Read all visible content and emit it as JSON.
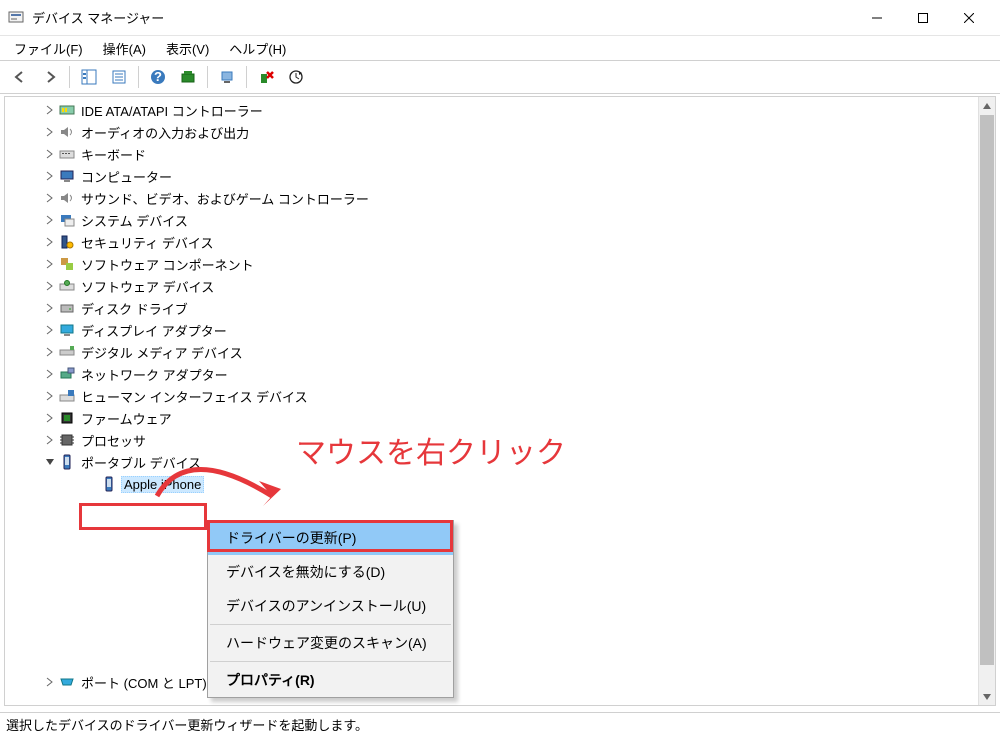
{
  "window": {
    "title": "デバイス マネージャー"
  },
  "menu": {
    "file": "ファイル(F)",
    "action": "操作(A)",
    "view": "表示(V)",
    "help": "ヘルプ(H)"
  },
  "tree": {
    "nodes": [
      {
        "label": "IDE ATA/ATAPI コントローラー"
      },
      {
        "label": "オーディオの入力および出力"
      },
      {
        "label": "キーボード"
      },
      {
        "label": "コンピューター"
      },
      {
        "label": "サウンド、ビデオ、およびゲーム コントローラー"
      },
      {
        "label": "システム デバイス"
      },
      {
        "label": "セキュリティ デバイス"
      },
      {
        "label": "ソフトウェア コンポーネント"
      },
      {
        "label": "ソフトウェア デバイス"
      },
      {
        "label": "ディスク ドライブ"
      },
      {
        "label": "ディスプレイ アダプター"
      },
      {
        "label": "デジタル メディア デバイス"
      },
      {
        "label": "ネットワーク アダプター"
      },
      {
        "label": "ヒューマン インターフェイス デバイス"
      },
      {
        "label": "ファームウェア"
      },
      {
        "label": "プロセッサ"
      },
      {
        "label": "ポータブル デバイス",
        "expanded": true
      },
      {
        "label": "ポート (COM と LPT)"
      }
    ],
    "selected_child": "Apple iPhone"
  },
  "contextmenu": {
    "update_driver": "ドライバーの更新(P)",
    "disable_device": "デバイスを無効にする(D)",
    "uninstall_device": "デバイスのアンインストール(U)",
    "scan_hardware": "ハードウェア変更のスキャン(A)",
    "properties": "プロパティ(R)"
  },
  "statusbar": {
    "text": "選択したデバイスのドライバー更新ウィザードを起動します。"
  },
  "annotation": {
    "right_click": "マウスを右クリック"
  }
}
